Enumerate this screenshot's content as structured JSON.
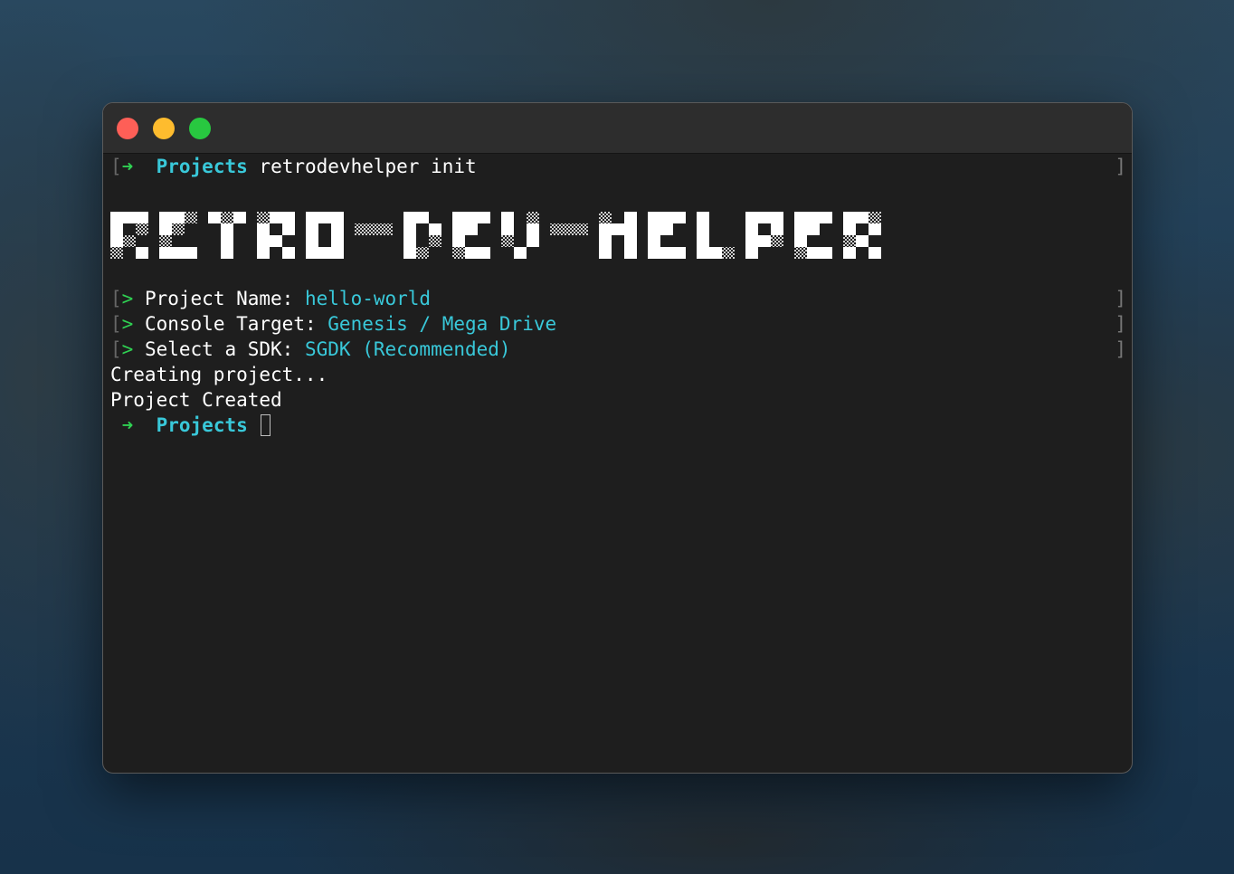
{
  "window": {
    "buttons": [
      "close",
      "minimize",
      "zoom"
    ]
  },
  "terminal": {
    "prompt_arrow": "➜",
    "command_line": {
      "bracket_left": "[",
      "dir": "Projects",
      "command": "retrodevhelper init",
      "bracket_right": "]"
    },
    "banner_text": "RETRO-DEV-HELPER",
    "questions": [
      {
        "marker": ">",
        "label": "Project Name:",
        "value": "hello-world"
      },
      {
        "marker": ">",
        "label": "Console Target:",
        "value": "Genesis / Mega Drive"
      },
      {
        "marker": ">",
        "label": "Select a SDK:",
        "value": "SGDK (Recommended)"
      }
    ],
    "output_lines": [
      "Creating project...",
      "Project Created"
    ],
    "final_prompt": {
      "dir": "Projects"
    }
  },
  "colors": {
    "prompt_green": "#2fd152",
    "accent_cyan": "#39c8d9",
    "background": "#1e1e1e"
  }
}
